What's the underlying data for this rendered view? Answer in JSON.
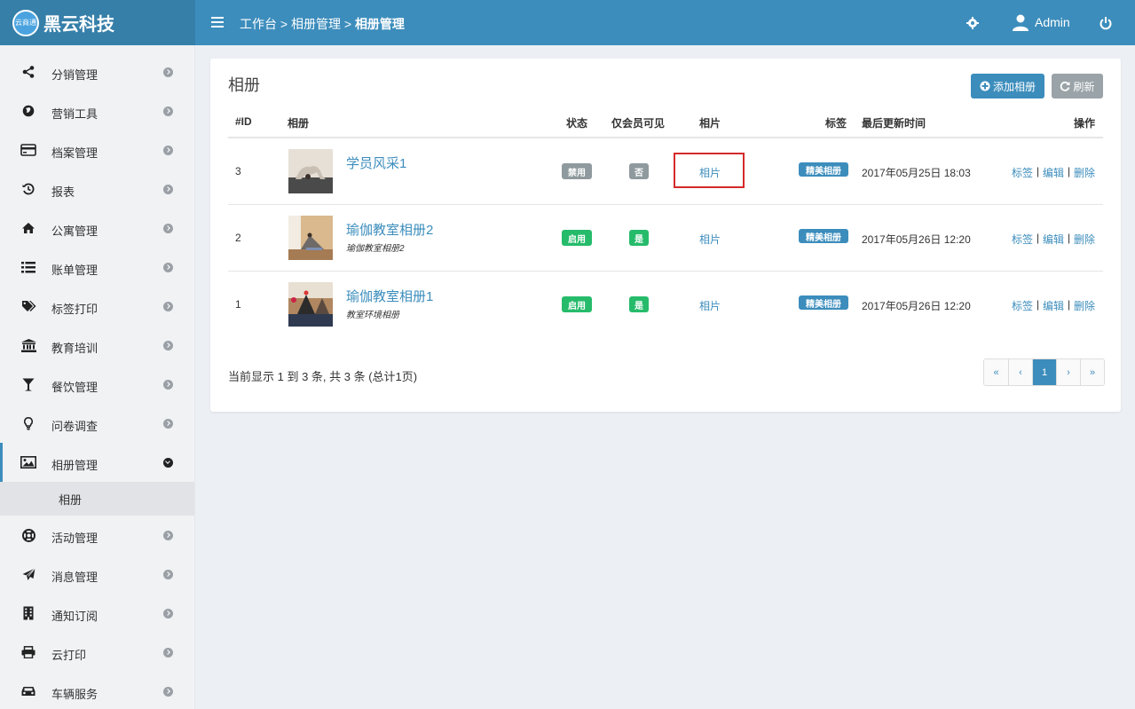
{
  "brand": {
    "logo_text": "云商通",
    "name": "黑云科技"
  },
  "breadcrumb": {
    "home": "工作台",
    "sep": ">",
    "parent": "相册管理",
    "current": "相册管理"
  },
  "header": {
    "user_name": "Admin"
  },
  "sidebar": {
    "items": [
      {
        "label": "分销管理",
        "icon": "share-icon"
      },
      {
        "label": "营销工具",
        "icon": "globe-icon"
      },
      {
        "label": "档案管理",
        "icon": "credit-card-icon"
      },
      {
        "label": "报表",
        "icon": "history-icon"
      },
      {
        "label": "公寓管理",
        "icon": "home-icon"
      },
      {
        "label": "账单管理",
        "icon": "list-icon"
      },
      {
        "label": "标签打印",
        "icon": "tags-icon"
      },
      {
        "label": "教育培训",
        "icon": "institution-icon"
      },
      {
        "label": "餐饮管理",
        "icon": "glass-icon"
      },
      {
        "label": "问卷调查",
        "icon": "lightbulb-icon"
      },
      {
        "label": "相册管理",
        "icon": "image-icon"
      },
      {
        "label": "活动管理",
        "icon": "life-ring-icon"
      },
      {
        "label": "消息管理",
        "icon": "paper-plane-icon"
      },
      {
        "label": "通知订阅",
        "icon": "building-icon"
      },
      {
        "label": "云打印",
        "icon": "print-icon"
      },
      {
        "label": "车辆服务",
        "icon": "car-icon"
      }
    ],
    "sub_item": "相册"
  },
  "box": {
    "title": "相册",
    "add_button": "添加相册",
    "refresh_button": "刷新"
  },
  "table": {
    "headers": {
      "id": "#ID",
      "album": "相册",
      "status": "状态",
      "members_only": "仅会员可见",
      "photos": "相片",
      "tags": "标签",
      "updated": "最后更新时间",
      "actions": "操作"
    },
    "rows": [
      {
        "id": "3",
        "name": "学员风采1",
        "desc": "",
        "status": "禁用",
        "members_only": "否",
        "photos": "相片",
        "tag": "精美相册",
        "updated": "2017年05月25日 18:03",
        "act_tag": "标签",
        "act_edit": "编辑",
        "act_delete": "删除"
      },
      {
        "id": "2",
        "name": "瑜伽教室相册2",
        "desc": "瑜伽教室相册2",
        "status": "启用",
        "members_only": "是",
        "photos": "相片",
        "tag": "精美相册",
        "updated": "2017年05月26日 12:20",
        "act_tag": "标签",
        "act_edit": "编辑",
        "act_delete": "删除"
      },
      {
        "id": "1",
        "name": "瑜伽教室相册1",
        "desc": "教室环境相册",
        "status": "启用",
        "members_only": "是",
        "photos": "相片",
        "tag": "精美相册",
        "updated": "2017年05月26日 12:20",
        "act_tag": "标签",
        "act_edit": "编辑",
        "act_delete": "删除"
      }
    ],
    "separator": "|"
  },
  "footer": {
    "summary": "当前显示 1 到 3 条, 共 3 条 (总计1页)",
    "pager": {
      "first": "«",
      "prev": "‹",
      "current": "1",
      "next": "›",
      "last": "»"
    }
  },
  "colors": {
    "primary": "#3c8dbc",
    "brand_bg": "#367fa9",
    "green": "#26bb6b",
    "gray": "#8f9a9e",
    "highlight": "#d42a2a"
  }
}
